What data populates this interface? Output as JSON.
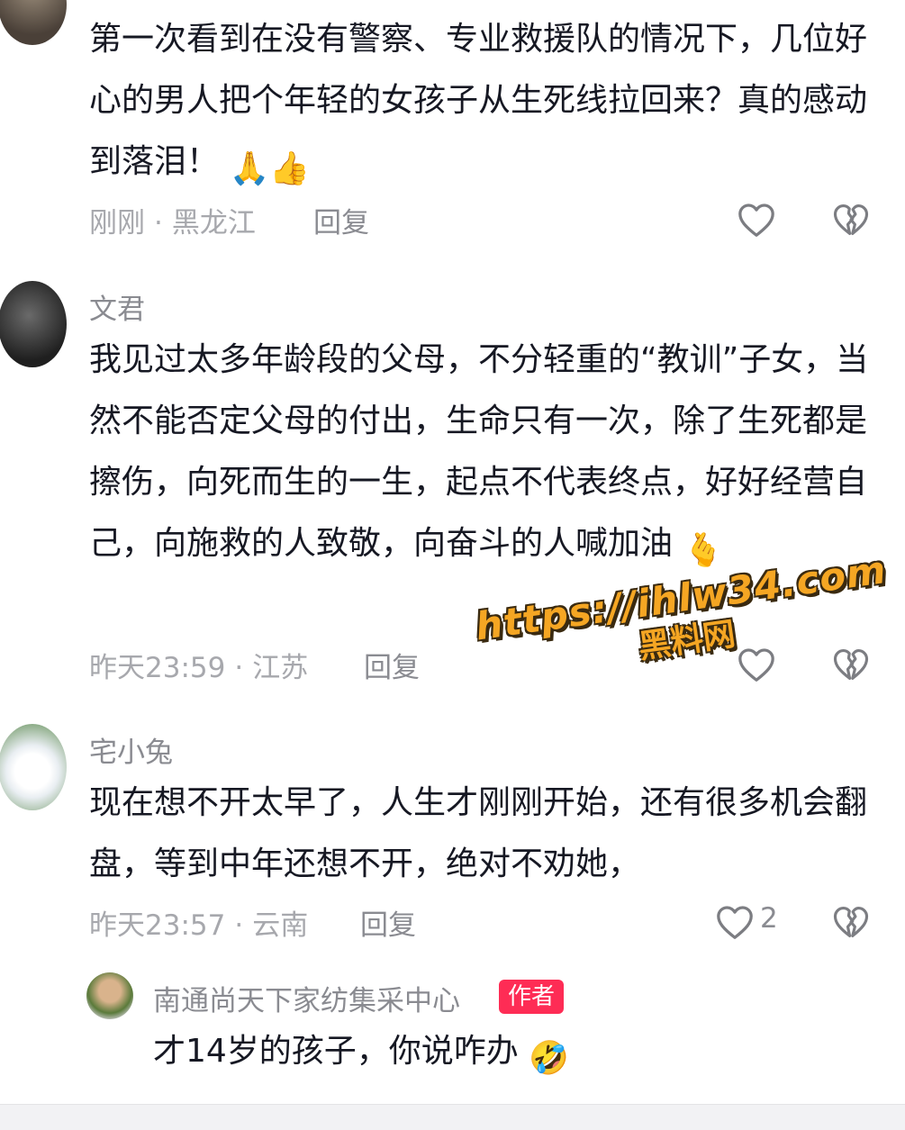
{
  "comments": [
    {
      "content": "第一次看到在没有警察、专业救援队的情况下，几位好心的男人把个年轻的女孩子从生死线拉回来？真的感动到落泪！",
      "emoji": "🙏👍",
      "time": "刚刚",
      "location": "黑龙江",
      "reply_label": "回复"
    },
    {
      "username": "文君",
      "content": "我见过太多年龄段的父母，不分轻重的“教训”子女，当然不能否定父母的付出，生命只有一次，除了生死都是擦伤，向死而生的一生，起点不代表终点，好好经营自己，向施救的人致敬，向奋斗的人喊加油",
      "emoji": "🫰",
      "time": "昨天23:59",
      "location": "江苏",
      "reply_label": "回复"
    },
    {
      "username": "宅小兔",
      "content": "现在想不开太早了，人生才刚刚开始，还有很多机会翻盘，等到中年还想不开，绝对不劝她，",
      "time": "昨天23:57",
      "location": "云南",
      "reply_label": "回复",
      "like_count": "2"
    },
    {
      "username": "南通尚天下家纺集采中心",
      "badge": "作者",
      "content": "才14岁的孩子，你说咋办",
      "emoji": "🤣"
    }
  ],
  "watermark": {
    "url": "https://ihlw34.com",
    "site": "黑料网"
  },
  "colors": {
    "text": "#161823",
    "muted": "#8a8b91",
    "badge": "#fe2c55",
    "watermark": "#f5a623"
  }
}
